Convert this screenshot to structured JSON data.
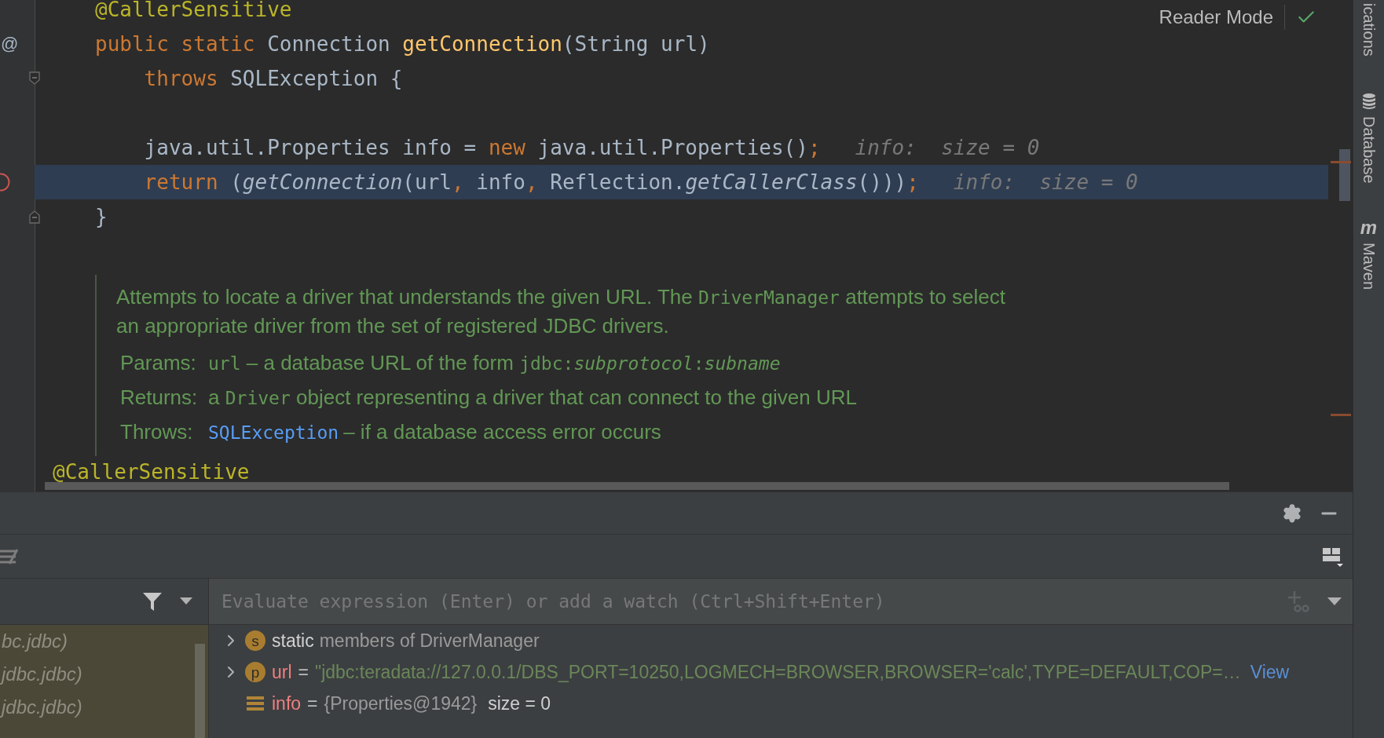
{
  "editor": {
    "reader_mode": {
      "label": "Reader Mode",
      "checked": true
    },
    "lines": [
      {
        "tokens": [
          {
            "kind": "annotation",
            "text": "@CallerSensitive"
          }
        ],
        "breakpoint": false,
        "current": false,
        "fold_open": false,
        "fold_close": false
      },
      {
        "tokens": [
          {
            "kind": "keyword",
            "text": "public static"
          },
          {
            "kind": "plain",
            "text": " Connection "
          },
          {
            "kind": "method",
            "text": "getConnection"
          },
          {
            "kind": "plain",
            "text": "(String url)"
          }
        ],
        "gutter": "@",
        "breakpoint": false,
        "current": false,
        "fold_open": false,
        "fold_close": false
      },
      {
        "tokens": [
          {
            "kind": "keyword",
            "text": "    throws"
          },
          {
            "kind": "plain",
            "text": " SQLException {"
          }
        ],
        "breakpoint": false,
        "current": false,
        "fold_open": true,
        "fold_close": false
      },
      {
        "breakpoint": false,
        "current": false,
        "fold_open": false,
        "fold_close": false
      },
      {
        "tokens": [
          {
            "kind": "plain",
            "text": "    java.util.Properties info = "
          },
          {
            "kind": "keyword",
            "text": "new"
          },
          {
            "kind": "plain",
            "text": " java.util.Properties()"
          },
          {
            "kind": "punct",
            "text": ";"
          }
        ],
        "hint": "info:  size = 0",
        "breakpoint": false,
        "current": false,
        "fold_open": false,
        "fold_close": false
      },
      {
        "tokens": [
          {
            "kind": "keyword",
            "text": "    return"
          },
          {
            "kind": "plain",
            "text": " ("
          },
          {
            "kind": "static_call",
            "text": "getConnection"
          },
          {
            "kind": "plain",
            "text": "(url"
          },
          {
            "kind": "punct",
            "text": ","
          },
          {
            "kind": "plain",
            "text": " info"
          },
          {
            "kind": "punct",
            "text": ","
          },
          {
            "kind": "plain",
            "text": " Reflection."
          },
          {
            "kind": "static_call",
            "text": "getCallerClass"
          },
          {
            "kind": "plain",
            "text": "()))"
          },
          {
            "kind": "punct",
            "text": ";"
          }
        ],
        "hint": "info:  size = 0",
        "breakpoint": true,
        "current": true,
        "fold_open": false,
        "fold_close": false
      },
      {
        "tokens": [
          {
            "kind": "plain",
            "text": "}"
          }
        ],
        "breakpoint": false,
        "current": false,
        "fold_open": false,
        "fold_close": true
      }
    ],
    "doc": {
      "description": [
        {
          "kind": "text",
          "text": "Attempts to locate a driver that understands the given URL. The "
        },
        {
          "kind": "code",
          "text": "DriverManager"
        },
        {
          "kind": "text",
          "text": " attempts to select an appropriate driver from the set of registered JDBC drivers."
        }
      ],
      "sections": [
        {
          "label": "Params:",
          "content": [
            {
              "kind": "code",
              "text": "url"
            },
            {
              "kind": "text",
              "text": " – a database URL of the form "
            },
            {
              "kind": "code",
              "text": "jdbc:"
            },
            {
              "kind": "code_italic",
              "text": "subprotocol"
            },
            {
              "kind": "code",
              "text": ":"
            },
            {
              "kind": "code_italic",
              "text": "subname"
            }
          ]
        },
        {
          "label": "Returns:",
          "content": [
            {
              "kind": "text",
              "text": "a "
            },
            {
              "kind": "code",
              "text": "Driver"
            },
            {
              "kind": "text",
              "text": " object representing a driver that can connect to the given URL"
            }
          ]
        },
        {
          "label": "Throws:",
          "content": [
            {
              "kind": "link",
              "text": "SQLException"
            },
            {
              "kind": "text",
              "text": " – if a database access error occurs"
            }
          ]
        }
      ]
    },
    "next_line": {
      "tokens": [
        {
          "kind": "annotation",
          "text": "@CallerSensitive"
        }
      ]
    }
  },
  "tool_strip": [
    {
      "kind": "plain",
      "label": "ications"
    },
    {
      "kind": "database",
      "label": "Database"
    },
    {
      "kind": "letter",
      "icon_text": "m",
      "label": "Maven"
    }
  ],
  "debugger": {
    "frames": [
      {
        "text": "bc.jdbc)"
      },
      {
        "text": "jdbc.jdbc)"
      },
      {
        "text": "jdbc.jdbc)"
      }
    ],
    "evaluate": {
      "placeholder": "Evaluate expression (Enter) or add a watch (Ctrl+Shift+Enter)"
    },
    "variables": [
      {
        "kind": "static",
        "badge": "s",
        "expandable": true,
        "name": "static",
        "value": "members of DriverManager",
        "is_string": false
      },
      {
        "kind": "parameter",
        "badge": "p",
        "expandable": true,
        "name": "url",
        "separator": "=",
        "value": "\"jdbc:teradata://127.0.0.1/DBS_PORT=10250,LOGMECH=BROWSER,BROWSER='calc',TYPE=DEFAULT,COP=…",
        "is_string": true,
        "link": "View"
      },
      {
        "kind": "field",
        "expandable": false,
        "name": "info",
        "separator": "=",
        "value": "{Properties@1942}",
        "is_string": false,
        "suffix": "size = 0"
      }
    ]
  }
}
